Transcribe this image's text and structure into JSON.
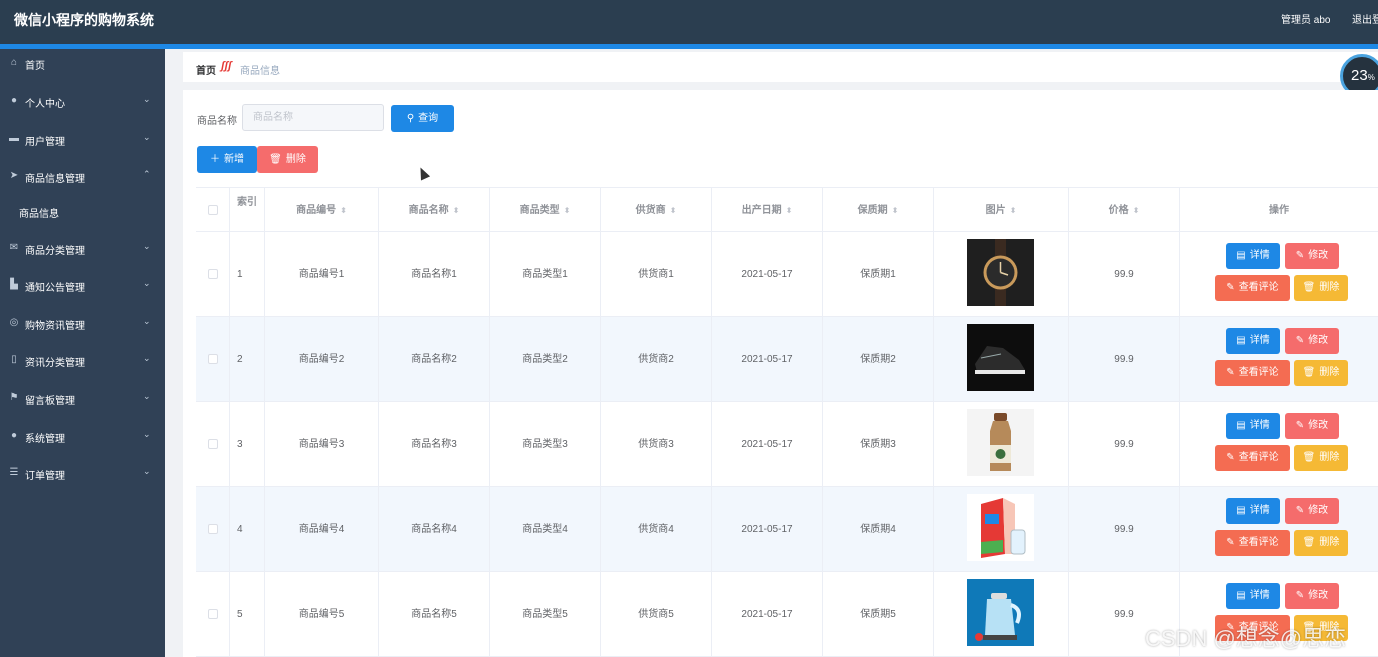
{
  "header": {
    "title": "微信小程序的购物系统",
    "admin_label": "管理员 abo",
    "logout_label": "退出登录"
  },
  "sidebar": {
    "items": [
      {
        "label": "首页",
        "icon": "home-icon",
        "has_arrow": false
      },
      {
        "label": "个人中心",
        "icon": "user-icon",
        "has_arrow": true
      },
      {
        "label": "用户管理",
        "icon": "monitor-icon",
        "has_arrow": true
      },
      {
        "label": "商品信息管理",
        "icon": "send-icon",
        "has_arrow": true,
        "expanded": true
      },
      {
        "label": "商品分类管理",
        "icon": "mail-icon",
        "has_arrow": true
      },
      {
        "label": "通知公告管理",
        "icon": "house-icon",
        "has_arrow": true
      },
      {
        "label": "购物资讯管理",
        "icon": "compass-icon",
        "has_arrow": true
      },
      {
        "label": "资讯分类管理",
        "icon": "phone-icon",
        "has_arrow": true
      },
      {
        "label": "留言板管理",
        "icon": "flag-icon",
        "has_arrow": true
      },
      {
        "label": "系统管理",
        "icon": "user-icon",
        "has_arrow": true
      },
      {
        "label": "订单管理",
        "icon": "list-icon",
        "has_arrow": true
      }
    ],
    "sub_item": "商品信息"
  },
  "breadcrumb": {
    "home": "首页",
    "separator": "ʃʃʃ",
    "current": "商品信息"
  },
  "progress_badge": {
    "value": "23",
    "unit": "%"
  },
  "search": {
    "label": "商品名称",
    "placeholder": "商品名称",
    "button_label": "查询"
  },
  "actions": {
    "add_label": "新增",
    "delete_label": "删除"
  },
  "table": {
    "headers": {
      "index": "索引",
      "code": "商品编号",
      "name": "商品名称",
      "type": "商品类型",
      "supplier": "供货商",
      "date": "出产日期",
      "shelf": "保质期",
      "image": "图片",
      "price": "价格",
      "ops": "操作"
    },
    "row_buttons": {
      "detail": "详情",
      "edit": "修改",
      "comments": "查看评论",
      "delete": "删除"
    },
    "rows": [
      {
        "index": "1",
        "code": "商品编号1",
        "name": "商品名称1",
        "type": "商品类型1",
        "supplier": "供货商1",
        "date": "2021-05-17",
        "shelf": "保质期1",
        "price": "99.9",
        "image_kind": "watch"
      },
      {
        "index": "2",
        "code": "商品编号2",
        "name": "商品名称2",
        "type": "商品类型2",
        "supplier": "供货商2",
        "date": "2021-05-17",
        "shelf": "保质期2",
        "price": "99.9",
        "image_kind": "shoes"
      },
      {
        "index": "3",
        "code": "商品编号3",
        "name": "商品名称3",
        "type": "商品类型3",
        "supplier": "供货商3",
        "date": "2021-05-17",
        "shelf": "保质期3",
        "price": "99.9",
        "image_kind": "bottle"
      },
      {
        "index": "4",
        "code": "商品编号4",
        "name": "商品名称4",
        "type": "商品类型4",
        "supplier": "供货商4",
        "date": "2021-05-17",
        "shelf": "保质期4",
        "price": "99.9",
        "image_kind": "milk"
      },
      {
        "index": "5",
        "code": "商品编号5",
        "name": "商品名称5",
        "type": "商品类型5",
        "supplier": "供货商5",
        "date": "2021-05-17",
        "shelf": "保质期5",
        "price": "99.9",
        "image_kind": "kettle"
      }
    ]
  },
  "watermark": "CSDN @想念@思恋",
  "colors": {
    "topbar": "#2b3e50",
    "sidebar": "#304156",
    "primary": "#1e88e5",
    "danger": "#f56c6c",
    "warning": "#f5b935",
    "row_alt": "#f2f7fd"
  }
}
